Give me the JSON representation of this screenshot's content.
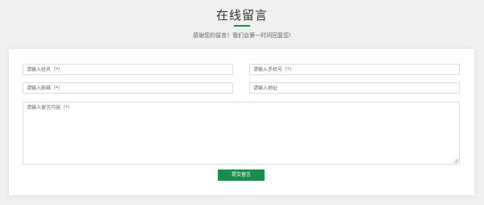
{
  "header": {
    "title": "在线留言",
    "subtitle": "感谢您的留言！我们会第一时间回复您!"
  },
  "form": {
    "name_placeholder": "请输入姓名（*）",
    "phone_placeholder": "请输入手机号（*）",
    "email_placeholder": "请输入邮箱（*）",
    "address_placeholder": "请输入地址",
    "message_placeholder": "请输入留言内容（*）",
    "submit_label": "提交留言"
  },
  "colors": {
    "accent": "#1a8c4c",
    "background": "#f0f0f0"
  }
}
